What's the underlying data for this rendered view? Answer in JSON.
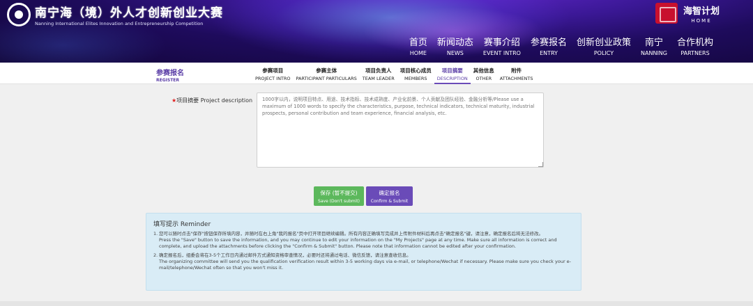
{
  "header": {
    "logo_cn": "南宁海（境）外人才创新创业大赛",
    "logo_en": "Nanning International Elites Innovation and Entrepreneurship Competition",
    "brand_cn": "海智计划",
    "brand_en": "HOME",
    "nav": [
      {
        "cn": "首页",
        "en": "HOME"
      },
      {
        "cn": "新闻动态",
        "en": "NEWS"
      },
      {
        "cn": "赛事介绍",
        "en": "EVENT INTRO"
      },
      {
        "cn": "参赛报名",
        "en": "ENTRY"
      },
      {
        "cn": "创新创业政策",
        "en": "POLICY"
      },
      {
        "cn": "南宁",
        "en": "NANNING"
      },
      {
        "cn": "合作机构",
        "en": "PARTNERS"
      }
    ]
  },
  "register": {
    "cn": "参赛报名",
    "en": "REGISTER"
  },
  "steps": [
    {
      "cn": "参赛项目",
      "en": "PROJECT INTRO"
    },
    {
      "cn": "参赛主体",
      "en": "PARTICIPANT PARTICULARS"
    },
    {
      "cn": "项目负责人",
      "en": "TEAM LEADER"
    },
    {
      "cn": "项目核心成员",
      "en": "MEMBERS"
    },
    {
      "cn": "项目摘要",
      "en": "DESCRIPTION"
    },
    {
      "cn": "其他信息",
      "en": "OTHER"
    },
    {
      "cn": "附件",
      "en": "ATTACHMENTS"
    }
  ],
  "active_step": 4,
  "form": {
    "required_mark": "★",
    "label": "项目摘要 Project description",
    "placeholder": "1000字以内，说明项目特点、用途、技术指标、技术成熟度、产业化前景、个人贡献及团队经验、金融分析等/Please use a maximum of 1000 words to specify the characteristics, purpose, technical indicators, technical maturity, industrial prospects, personal contribution and team experience, financial analysis, etc.",
    "value": ""
  },
  "buttons": {
    "save_cn": "保存 (暂不提交)",
    "save_en": "Save (Don't submit)",
    "confirm_cn": "确定报名",
    "confirm_en": "Confirm & Submit"
  },
  "reminder": {
    "title": "填写提示 Reminder",
    "items": [
      {
        "num": "1.",
        "cn": "您可以随时点击\"保存\"按钮保存所填内容，并随时在右上角\"我的报名\"页中打开项目继续编辑。所有内容正确填写完成并上传附件材料后再点击\"确定报名\"键，请注意，确定报名后将无法修改。",
        "en": "Press the \"Save\" button to save the information, and you may continue to edit your information on the \"My Projects\" page at any time. Make sure all information is correct and complete, and upload the attachments before clicking the \"Confirm & Submit\" button. Please note that information cannot be edited after your confirmation."
      },
      {
        "num": "2.",
        "cn": "确定报名后，组委会将在3-5个工作日内通过邮件方式通知资格审查情况，必要时还将通过电话、微信反馈，请注意查收信息。",
        "en": "The organizing committee will send you the qualification verification result within 3-5 working days via e-mail, or telephone/Wechat if necessary. Please make sure you check your e-mail/telephone/Wechat often so that you won't miss it."
      }
    ]
  },
  "colors": {
    "accent": "#6a4bb8",
    "save": "#5cb85c",
    "required": "#e02020",
    "reminder_bg": "#d9ecf6"
  }
}
